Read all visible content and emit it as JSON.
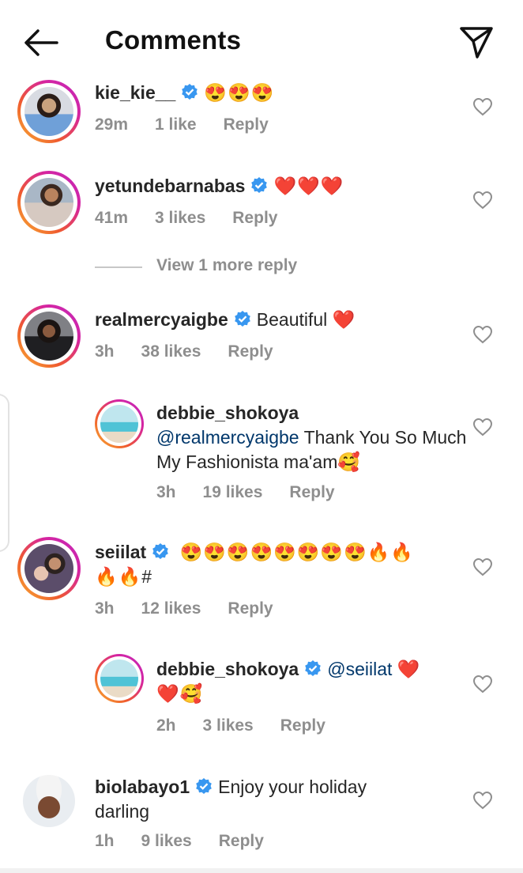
{
  "header": {
    "title": "Comments",
    "back_icon": "arrow-left-icon",
    "send_icon": "paper-plane-icon"
  },
  "colors": {
    "ring_start": "#f9b233",
    "ring_end": "#c02bc0",
    "verified": "#3897f0",
    "mention": "#00376b",
    "meta": "#8e8e8e",
    "heart_red": "#d7141a"
  },
  "comments": [
    {
      "username": "kie_kie__",
      "verified": true,
      "text": "",
      "emojis": "😍😍😍",
      "time": "29m",
      "likes": "1 like",
      "reply": "Reply"
    },
    {
      "username": "yetundebarnabas",
      "verified": true,
      "text": "",
      "emojis": "❤️❤️❤️",
      "time": "41m",
      "likes": "3 likes",
      "reply": "Reply"
    },
    {
      "username": "realmercyaigbe",
      "verified": true,
      "text": "Beautiful",
      "emojis": "❤️",
      "time": "3h",
      "likes": "38 likes",
      "reply": "Reply"
    },
    {
      "username": "debbie_shokoya",
      "verified": false,
      "mention": "@realmercyaigbe",
      "text": "Thank You So Much My Fashionista ma'am",
      "emojis": "🥰",
      "time": "3h",
      "likes": "19 likes",
      "reply": "Reply"
    },
    {
      "username": "seiilat",
      "verified": true,
      "text": "",
      "emojis": "😍😍😍😍😍😍😍😍🔥🔥",
      "emojis2": "🔥🔥#",
      "time": "3h",
      "likes": "12 likes",
      "reply": "Reply"
    },
    {
      "username": "debbie_shokoya",
      "verified": true,
      "mention": "@seiilat",
      "emojis": "❤️",
      "emojis2": "❤️🥰",
      "time": "2h",
      "likes": "3 likes",
      "reply": "Reply"
    },
    {
      "username": "biolabayo1",
      "verified": true,
      "text": "Enjoy your holiday",
      "text2": "darling",
      "time": "1h",
      "likes": "9 likes",
      "reply": "Reply"
    }
  ],
  "view_more_replies": "View 1 more reply"
}
